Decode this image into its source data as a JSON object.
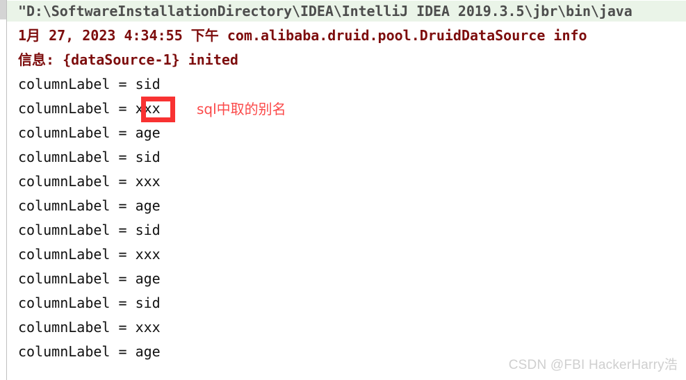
{
  "console": {
    "command_line": {
      "text": "\"D:\\SoftwareInstallationDirectory\\IDEA\\IntelliJ IDEA 2019.3.5\\jbr\\bin\\java",
      "truncated": true,
      "background_color": "#eaf4e8",
      "text_color": "#4d4d4d"
    },
    "log_lines": [
      {
        "text": "1月 27, 2023 4:34:55 下午 com.alibaba.druid.pool.DruidDataSource info",
        "color": "#7d0d0d"
      },
      {
        "text": "信息: {dataSource-1} inited",
        "color": "#7d0d0d"
      }
    ],
    "output_lines": [
      {
        "text": "columnLabel = sid"
      },
      {
        "text": "columnLabel = xxx"
      },
      {
        "text": "columnLabel = age"
      },
      {
        "text": "columnLabel = sid"
      },
      {
        "text": "columnLabel = xxx"
      },
      {
        "text": "columnLabel = age"
      },
      {
        "text": "columnLabel = sid"
      },
      {
        "text": "columnLabel = xxx"
      },
      {
        "text": "columnLabel = age"
      },
      {
        "text": "columnLabel = sid"
      },
      {
        "text": "columnLabel = xxx"
      },
      {
        "text": "columnLabel = age"
      }
    ],
    "output_text_color": "#111111"
  },
  "annotation": {
    "note_text": "sql中取的别名",
    "note_color": "#fb4a4a",
    "highlight_box_color": "#f83232",
    "highlighted_token": "xxx"
  },
  "watermark": {
    "text": "CSDN @FBI HackerHarry浩",
    "color": "#cfcfcf"
  }
}
